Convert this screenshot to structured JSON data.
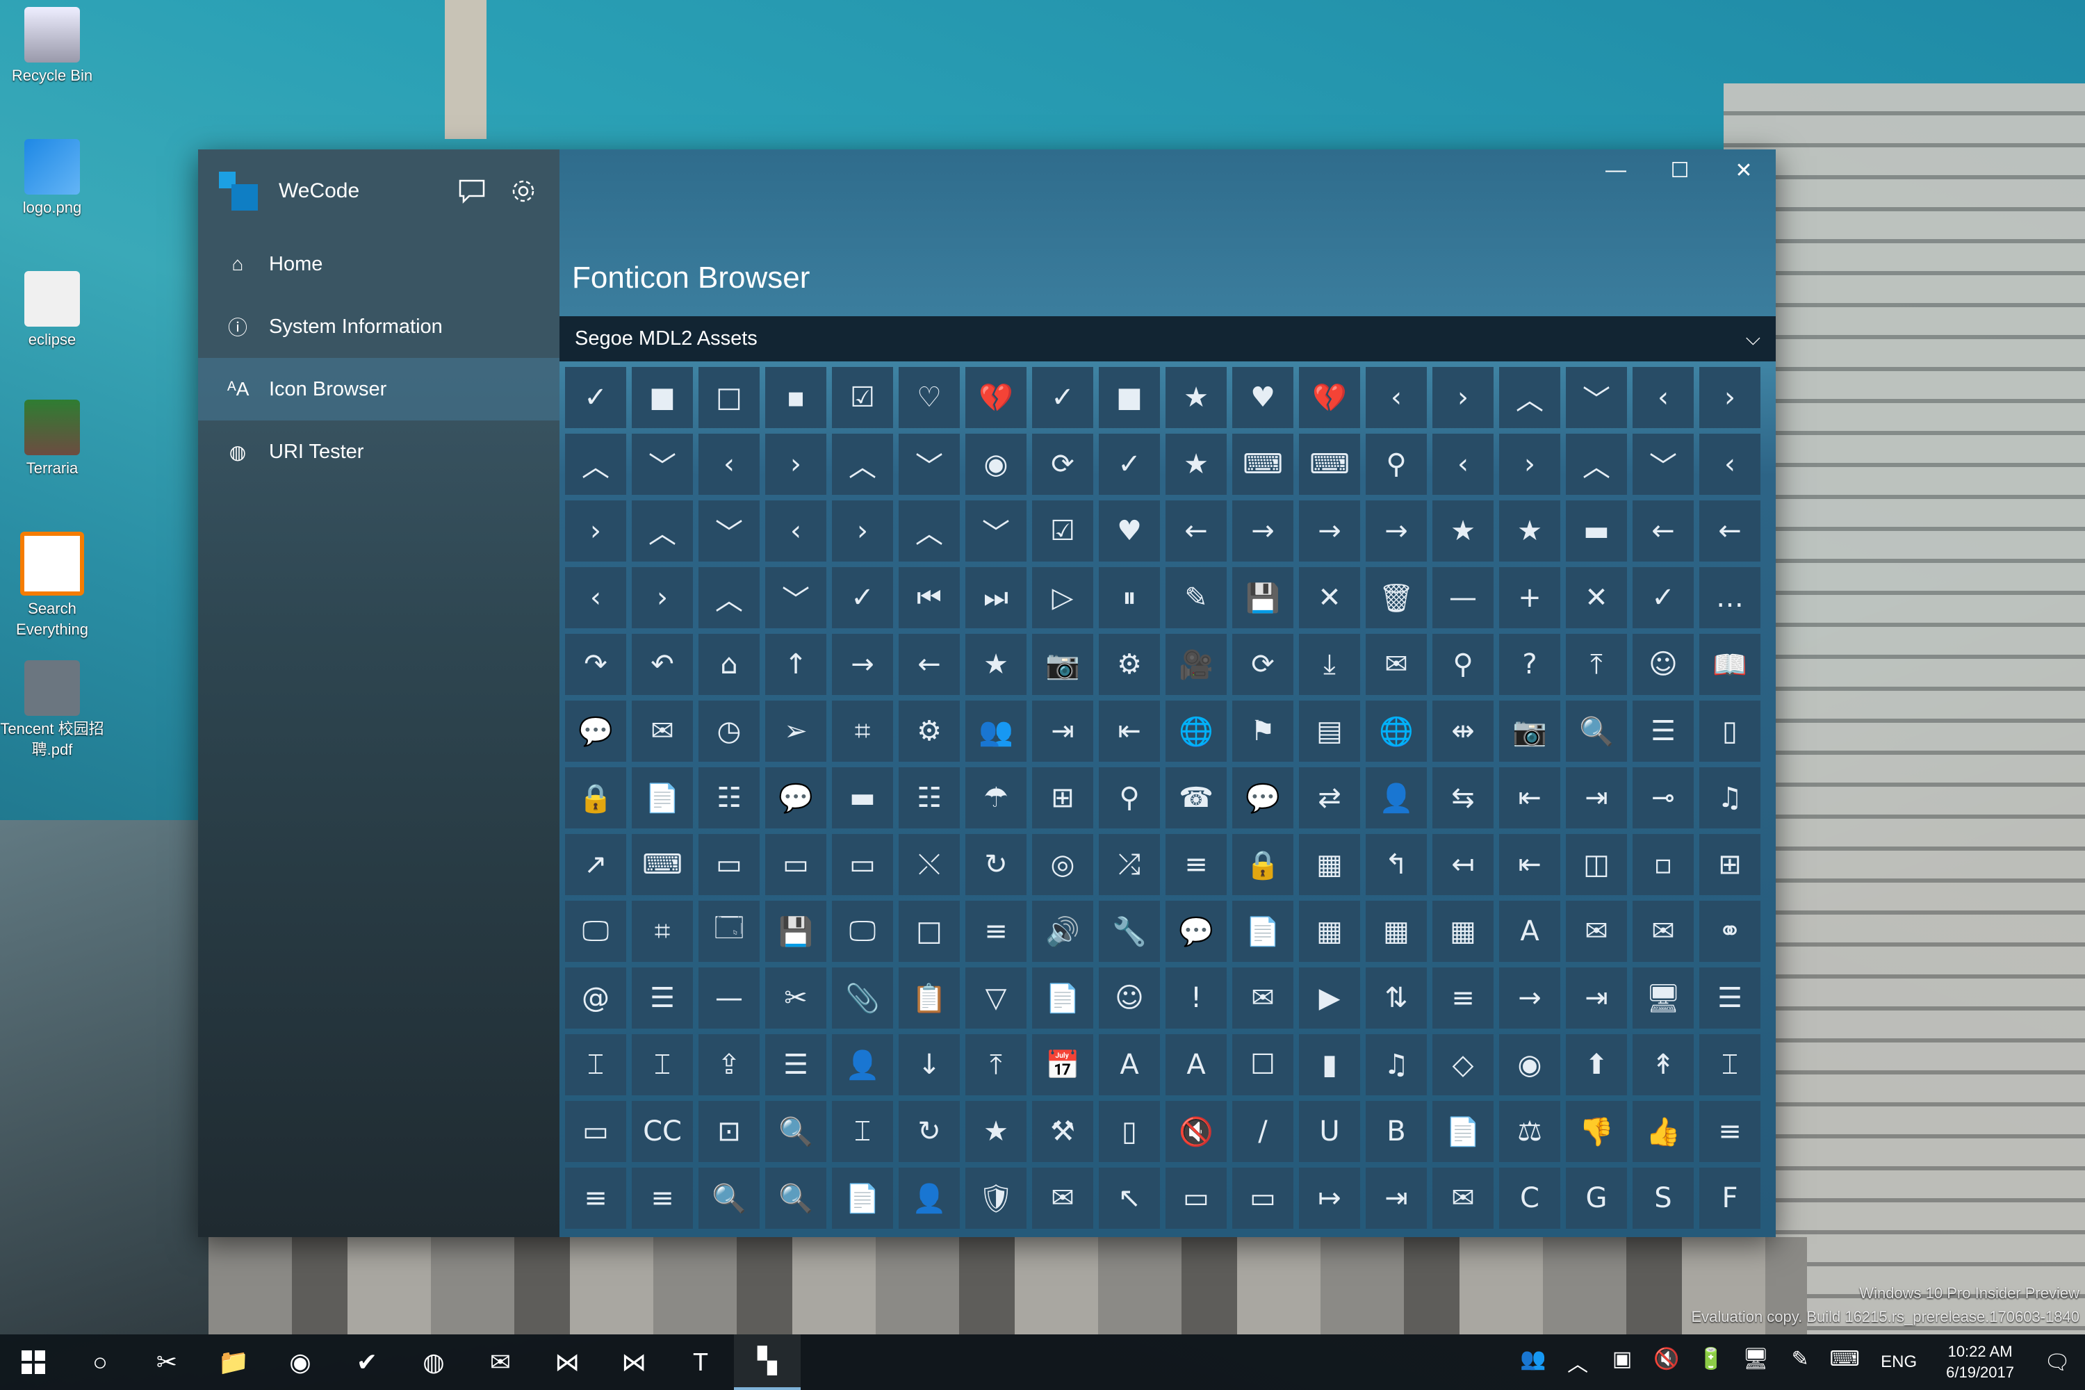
{
  "desktop": {
    "icons": [
      {
        "label": "Recycle Bin",
        "icon": "recycle-bin-icon"
      },
      {
        "label": "logo.png",
        "icon": "image-file-icon"
      },
      {
        "label": "eclipse",
        "icon": "eclipse-icon"
      },
      {
        "label": "Terraria",
        "icon": "terraria-icon"
      },
      {
        "label": "Search Everything",
        "icon": "search-everything-icon"
      },
      {
        "label": "Tencent 校园招聘.pdf",
        "icon": "pdf-file-icon"
      }
    ],
    "watermark": {
      "line1": "Windows 10 Pro Insider Preview",
      "line2": "Evaluation copy. Build 16215.rs_prerelease.170603-1840"
    }
  },
  "app": {
    "name": "WeCode",
    "feedback_icon": "feedback-icon",
    "settings_icon": "settings-gear-icon",
    "nav": [
      {
        "label": "Home",
        "icon": "⌂"
      },
      {
        "label": "System Information",
        "icon": "ⓘ"
      },
      {
        "label": "Icon Browser",
        "icon": "ᴬA"
      },
      {
        "label": "URI Tester",
        "icon": "◍"
      }
    ],
    "window_controls": {
      "minimize": "—",
      "maximize": "☐",
      "close": "✕"
    },
    "page_title": "Fonticon Browser",
    "font_selector": {
      "value": "Segoe MDL2 Assets",
      "chevron": "⌵"
    },
    "glyphs": [
      "✓",
      "■",
      "□",
      "▪",
      "☑",
      "♡",
      "💔",
      "✓",
      "■",
      "★",
      "♥",
      "💔",
      "‹",
      "›",
      "︿",
      "﹀",
      "‹",
      "›",
      "︿",
      "﹀",
      "‹",
      "›",
      "︿",
      "﹀",
      "◉",
      "⟳",
      "✓",
      "★",
      "⌨",
      "⌨",
      "⚲",
      "‹",
      "›",
      "︿",
      "﹀",
      "‹",
      "›",
      "︿",
      "﹀",
      "‹",
      "›",
      "︿",
      "﹀",
      "☑",
      "♥",
      "←",
      "→",
      "→",
      "→",
      "★",
      "★",
      "▬",
      "←",
      "←",
      "‹",
      "›",
      "︿",
      "﹀",
      "✓",
      "⏮",
      "⏭",
      "▷",
      "⏸",
      "✎",
      "💾",
      "✕",
      "🗑",
      "—",
      "+",
      "✕",
      "✓",
      "…",
      "↷",
      "↶",
      "⌂",
      "↑",
      "→",
      "←",
      "★",
      "📷",
      "⚙",
      "🎥",
      "⟳",
      "⤓",
      "✉",
      "⚲",
      "?",
      "⤒",
      "☺",
      "📖",
      "💬",
      "✉",
      "◷",
      "➢",
      "⌗",
      "⚙",
      "👥",
      "⇥",
      "⇤",
      "🌐",
      "⚑",
      "▤",
      "🌐",
      "⇹",
      "📷",
      "🔍",
      "☰",
      "▯",
      "🔒",
      "📄",
      "☷",
      "💬",
      "▬",
      "☷",
      "☂",
      "⊞",
      "⚲",
      "☎",
      "💬",
      "⇄",
      "👤",
      "⇆",
      "⇤",
      "⇥",
      "⊸",
      "♫",
      "↗",
      "⌨",
      "▭",
      "▭",
      "▭",
      "⤬",
      "↻",
      "◎",
      "⤮",
      "≡",
      "🔒",
      "▦",
      "↰",
      "↤",
      "⇤",
      "◫",
      "▫",
      "⊞",
      "🖵",
      "⌗",
      "🗔",
      "💾",
      "🖵",
      "□",
      "≡",
      "🔊",
      "🔧",
      "💬",
      "📄",
      "▦",
      "▦",
      "▦",
      "A",
      "✉",
      "✉",
      "⚭",
      "@",
      "☰",
      "—",
      "✂",
      "📎",
      "📋",
      "▽",
      "📄",
      "☺",
      "!",
      "✉",
      "▶",
      "⇅",
      "≡",
      "→",
      "⇥",
      "🖥",
      "☰",
      "⌶",
      "⌶",
      "⇪",
      "☰",
      "👤",
      "↓",
      "⤒",
      "📅",
      "A",
      "A",
      "☐",
      "▮",
      "♫",
      "◇",
      "◉",
      "⬆",
      "↟",
      "⌶",
      "▭",
      "CC",
      "⊡",
      "🔍",
      "⌶",
      "↻",
      "★",
      "⚒",
      "▯",
      "🔇",
      "/",
      "U",
      "B",
      "📄",
      "⚖",
      "👎",
      "👍",
      "≡",
      "≡",
      "≡",
      "🔍",
      "🔍",
      "📄",
      "👤",
      "🛡",
      "✉",
      "↖",
      "▭",
      "▭",
      "↦",
      "⇥",
      "✉",
      "C",
      "G",
      "S",
      "F"
    ]
  },
  "taskbar": {
    "start_icon": "windows-start-icon",
    "apps": [
      {
        "name": "cortana-icon",
        "glyph": "○"
      },
      {
        "name": "snipping-tool-icon",
        "glyph": "✂"
      },
      {
        "name": "file-explorer-icon",
        "glyph": "📁"
      },
      {
        "name": "chrome-icon",
        "glyph": "◉"
      },
      {
        "name": "todo-icon",
        "glyph": "✔"
      },
      {
        "name": "spotify-icon",
        "glyph": "◍"
      },
      {
        "name": "mail-icon",
        "glyph": "✉"
      },
      {
        "name": "visual-studio-icon",
        "glyph": "⋈"
      },
      {
        "name": "vscode-icon",
        "glyph": "⋈"
      },
      {
        "name": "typora-icon",
        "glyph": "T"
      },
      {
        "name": "wecode-taskbar-icon",
        "glyph": "▚"
      }
    ],
    "tray": {
      "icons": [
        "people-icon",
        "chevron-up-icon",
        "display-icon",
        "volume-mute-icon",
        "battery-icon",
        "network-icon",
        "pen-icon",
        "keyboard-icon"
      ],
      "glyphs": [
        "👥",
        "︿",
        "▣",
        "🔇",
        "🔋",
        "🖥",
        "✎",
        "⌨"
      ],
      "lang": "ENG",
      "time": "10:22 AM",
      "date": "6/19/2017",
      "notification_glyph": "🗨"
    }
  }
}
